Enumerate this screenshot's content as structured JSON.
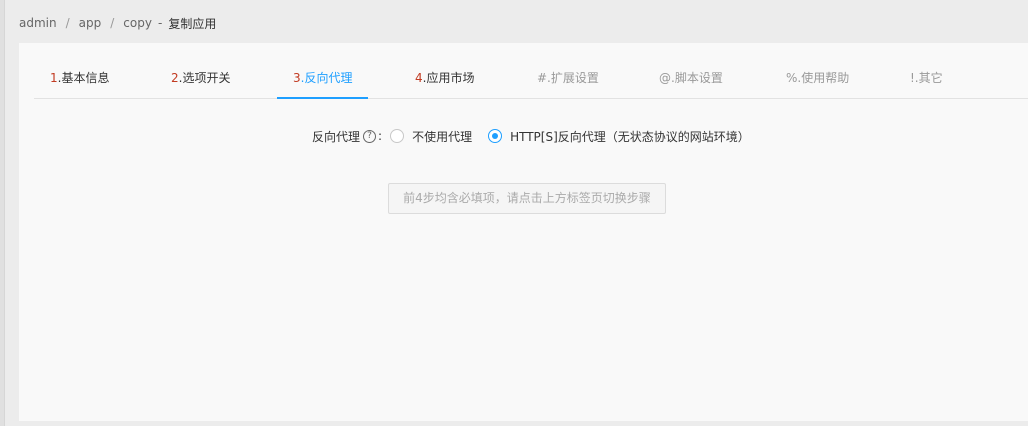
{
  "breadcrumb": {
    "items": [
      "admin",
      "app",
      "copy"
    ],
    "separator": "/",
    "dash": "-",
    "current": "复制应用"
  },
  "tabs": [
    {
      "num": "1",
      "label": ".基本信息"
    },
    {
      "num": "2",
      "label": ".选项开关"
    },
    {
      "num": "3",
      "label": ".反向代理"
    },
    {
      "num": "4",
      "label": ".应用市场"
    },
    {
      "label": "#.扩展设置"
    },
    {
      "label": "@.脚本设置"
    },
    {
      "label": "%.使用帮助"
    },
    {
      "label": "!.其它"
    }
  ],
  "active_tab": "3.反向代理",
  "form": {
    "label": "反向代理",
    "help_icon": "question-circle-icon",
    "help_glyph": "?",
    "colon": ":",
    "options": [
      {
        "label": "不使用代理",
        "checked": false
      },
      {
        "label": "HTTP[S]反向代理（无状态协议的网站环境）",
        "checked": true
      }
    ]
  },
  "notice_button": "前4步均含必填项，请点击上方标签页切换步骤",
  "colors": {
    "accent": "#1e9fff",
    "step_number": "#c23b22",
    "muted_tab": "#999999"
  }
}
